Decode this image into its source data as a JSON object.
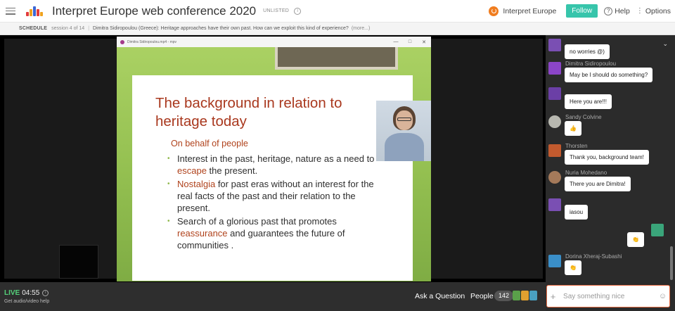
{
  "header": {
    "title": "Interpret Europe web conference 2020",
    "visibility": "UNLISTED",
    "organizer": "Interpret Europe",
    "follow_label": "Follow",
    "help_label": "Help",
    "options_label": "Options",
    "logo_colors": [
      "#e23b3b",
      "#f0a21f",
      "#3b66d6",
      "#e23b3b",
      "#f0a21f"
    ]
  },
  "schedule": {
    "label": "SCHEDULE",
    "session": "session 4 of 14",
    "talk": "Dimitra Sidiropoulou (Greece): Heritage approaches have their own past. How can we exploit this kind of experience?",
    "more": "(more...)"
  },
  "presentation": {
    "window_title": "Dimitra Sidiropoulou.mp4 - mpv",
    "heading": "The background  in relation to heritage today",
    "subheading": "On behalf of people",
    "bullets": [
      {
        "pre": "Interest in the past, heritage, nature as a need to ",
        "hl": "escape",
        "post": " the present."
      },
      {
        "pre": "",
        "hl": "Nostalgia",
        "post": " for past eras without an interest for the real facts of the past and their relation to the present."
      },
      {
        "pre": "Search of a glorious past that promotes ",
        "hl": "reassurance",
        "post": " and guarantees the future of communities ."
      }
    ]
  },
  "bottom_bar": {
    "live_label": "LIVE",
    "live_time": "04:55",
    "help_link": "Get audio/video help",
    "ask_label": "Ask a Question",
    "people_label": "People",
    "people_count": "142"
  },
  "chat": {
    "messages": [
      {
        "author": "",
        "text": "no worries @)"
      },
      {
        "author": "Dimitra Sidiropoulou",
        "text": "May be I should do something?"
      },
      {
        "author": "",
        "text": "Here you are!!!"
      },
      {
        "author": "Sandy Colvine",
        "text": "👍"
      },
      {
        "author": "Thorsten",
        "text": "Thank you, background team!"
      },
      {
        "author": "Nuria Mohedano",
        "text": "There you are Dimitra!"
      },
      {
        "author": "",
        "text": "iasou"
      },
      {
        "author": "",
        "text": "👏"
      },
      {
        "author": "Dorina Xheraj-Subashi",
        "text": "👏"
      }
    ],
    "input_placeholder": "Say something nice"
  }
}
